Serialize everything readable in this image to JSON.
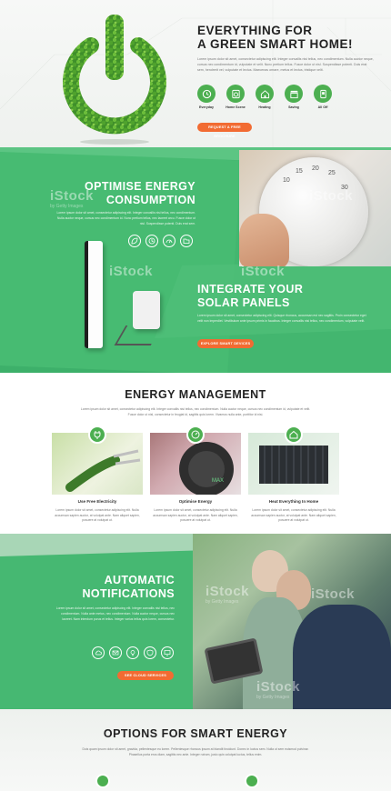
{
  "hero": {
    "title_line1": "EVERYTHING FOR",
    "title_line2": "A GREEN SMART HOME!",
    "text": "Lorem ipsum dolor sit amet, consectetur adipiscing elit. Integer convallis nisi tellus, nec condimentum. Nulla auctor neque, cursus nec condimentum id, vulputate et velit. Nunc pretium tellus. Fusce dolor ut nisl. Suspendisse potenti. Duis erat sem, hendrerit vel, vulputate et lectus. Maecenas ornare, metus et lectus, tristique velit.",
    "icons": [
      {
        "label": "Everyday",
        "icon": "clock-icon"
      },
      {
        "label": "Home Scene",
        "icon": "washer-icon"
      },
      {
        "label": "Heating",
        "icon": "house-icon"
      },
      {
        "label": "Saving",
        "icon": "shop-icon"
      },
      {
        "label": "All Off",
        "icon": "device-icon"
      }
    ],
    "button": "REQUEST A FREE BROCHURE"
  },
  "optimise": {
    "title_line1": "OPTIMISE ENERGY",
    "title_line2": "CONSUMPTION",
    "text": "Lorem ipsum dolor sit amet, consectetur adipiscing elit. Integer convallis nisi tellus, nec condimentum. Nulla auctor neque, cursus nec condimentum id. Nunc pretium tellus, nec laoreet arcu. Fusce dolor ut nisl. Suspendisse potenti. Duis erat sem."
  },
  "solar": {
    "title_line1": "INTEGRATE YOUR",
    "title_line2": "SOLAR PANELS",
    "text": "Lorem ipsum dolor sit amet, consectetur adipiscing elit. Quisque rhoncus, accumsan est nec sagittis. Proin consectetur eget velit non imperdiet. Vestibulum ante ipsum primis in faucibus. Integer convallis nisi tellus, nec condimentum, vulputate velit.",
    "button": "EXPLORE SMART DEVICES"
  },
  "management": {
    "title": "ENERGY MANAGEMENT",
    "text": "Lorem ipsum dolor sit amet, consectetur adipiscing elit. Integer convallis nisi tellus, nec condimentum. Nulla auctor neque, cursus nec condimentum id, vulputate et velit. Fusce dolor ut nisl, consectetur in feugiat id, sagittis quis lorem. Vivamus nulla ante, porttitor id nisi.",
    "cards": [
      {
        "title": "Use Free Electricity",
        "text": "Lorem ipsum dolor sit amet, consectetur adipiscing elit. Nulla accumsan sapien auctor, at volutpat ante. Nam aliquet sapien, posuere at volutpat ut."
      },
      {
        "title": "Optimise Energy",
        "text": "Lorem ipsum dolor sit amet, consectetur adipiscing elit. Nulla accumsan sapien auctor, at volutpat ante. Nam aliquet sapien, posuere at volutpat ut."
      },
      {
        "title": "Heat Everything In Home",
        "text": "Lorem ipsum dolor sit amet, consectetur adipiscing elit. Nulla accumsan sapien auctor, at volutpat ante. Nam aliquet sapien, posuere at volutpat ut."
      }
    ]
  },
  "notifications": {
    "title_line1": "AUTOMATIC",
    "title_line2": "NOTIFICATIONS",
    "text": "Lorem ipsum dolor sit amet, consectetur adipiscing elit. Integer convallis nisi tellus, nec condimentum. Nulla ante metus, nec condimentum. Nulla auctor neque, cursus nec laoreet. Nam interdum purus et tellus. Integer varius tellus quis lorem, consectetur.",
    "button": "SEE CLOUD SERVICES"
  },
  "options": {
    "title": "OPTIONS FOR SMART ENERGY",
    "text": "Duis quam ipsum dolor sit amet, gravida, pellentesque eu lorem. Pellentesque rhoncus ipsum at blandit tincidunt. Donec in luctus sem. Nulla ut sem euismod pulvinar. Phasellus porta eros diam, sagittis nec ante. Integer rutrum, justo quis volutpat luctus, tellus enim."
  },
  "watermark": {
    "brand": "iStock",
    "sub": "by Getty Images"
  },
  "colors": {
    "green": "#3db06a",
    "accent": "#4caf50",
    "orange": "#f26b32"
  }
}
